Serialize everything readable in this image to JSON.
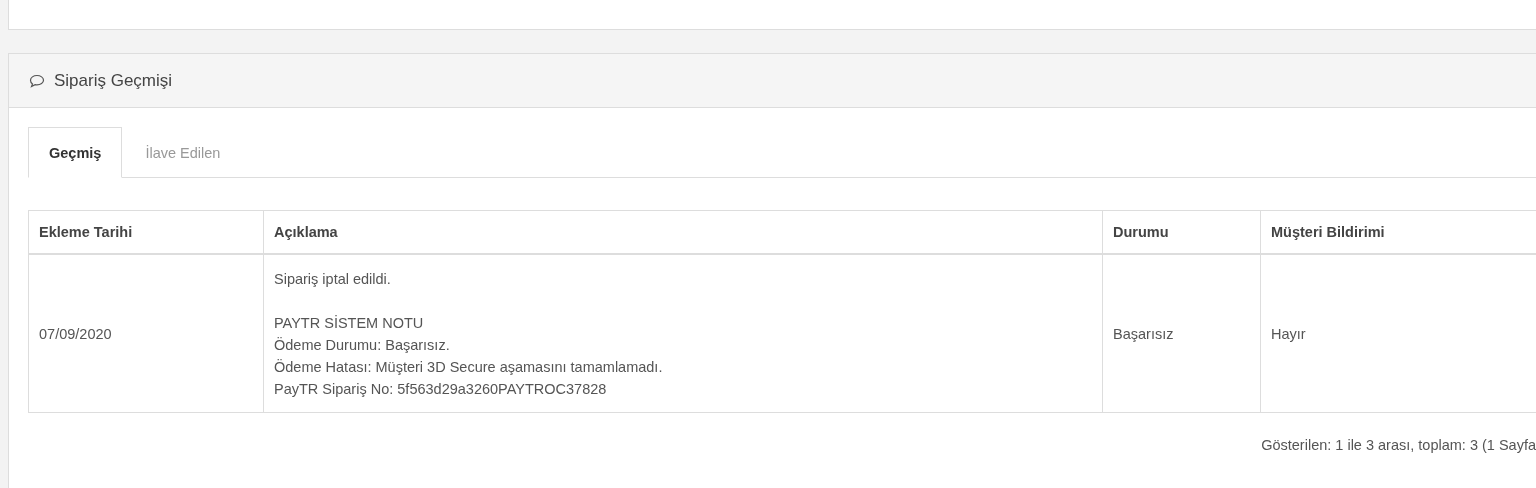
{
  "panel": {
    "title": "Sipariş Geçmişi"
  },
  "tabs": [
    {
      "label": "Geçmiş",
      "selected": true
    },
    {
      "label": "İlave Edilen",
      "selected": false
    }
  ],
  "table": {
    "columns": [
      "Ekleme Tarihi",
      "Açıklama",
      "Durumu",
      "Müşteri Bildirimi"
    ],
    "rows": [
      {
        "date": "07/09/2020",
        "description": [
          [
            "Sipariş iptal edildi."
          ],
          [
            "PAYTR SİSTEM NOTU",
            "Ödeme Durumu: Başarısız.",
            "Ödeme Hatası: Müşteri 3D Secure aşamasını tamamlamadı.",
            "PayTR Sipariş No: 5f563d29a3260PAYTROC37828"
          ]
        ],
        "status": "Başarısız",
        "notify": "Hayır"
      }
    ]
  },
  "pagination": "Gösterilen: 1 ile 3 arası, toplam: 3 (1 Sayfa"
}
